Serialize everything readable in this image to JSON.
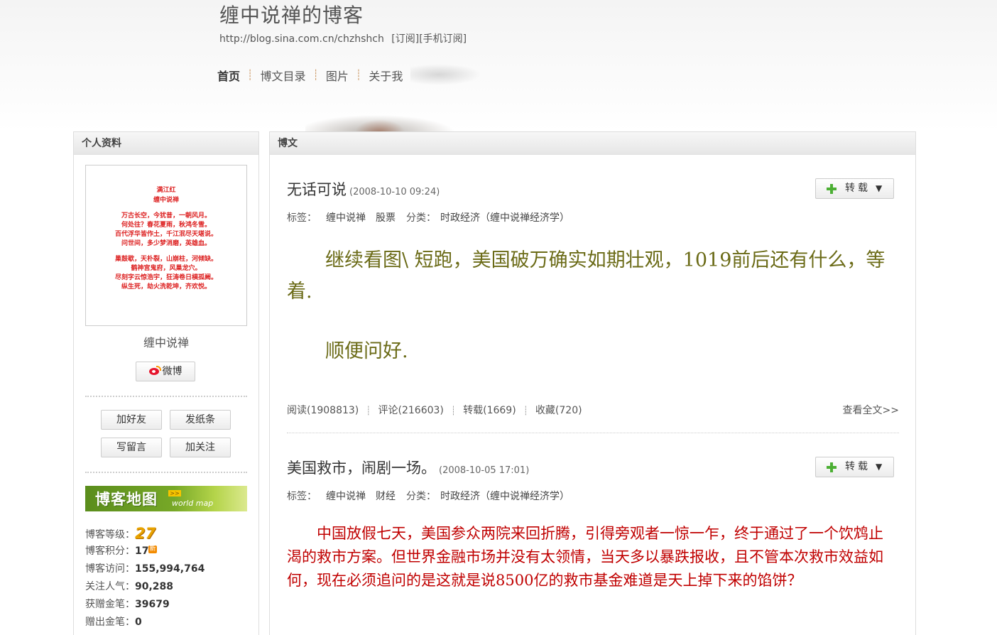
{
  "header": {
    "title": "缠中说禅的博客",
    "url": "http://blog.sina.com.cn/chzhshch",
    "subscribe": "[订阅]",
    "mobile_subscribe": "[手机订阅]"
  },
  "nav": {
    "items": [
      {
        "label": "首页"
      },
      {
        "label": "博文目录"
      },
      {
        "label": "图片"
      },
      {
        "label": "关于我"
      }
    ],
    "separator": "┊"
  },
  "sidebar": {
    "title": "个人资料",
    "poem": {
      "title": "满江红",
      "author": "缠中说禅",
      "lines1": [
        "万古长空，今犹昔，一朝风月。",
        "何处往？春花夏雨，秋鸿冬雪。",
        "百代浮华皆作土，千江泯尽天堪说。",
        "问世间，多少梦消磨，英雄血。"
      ],
      "lines2": [
        "巢鼓歇，天朴裂，山崩柱，河倾缺。",
        "鹤神宫鬼府，风巢龙穴。",
        "尽刻字云惊浩宇，狂涛卷日横孤阙。",
        "纵生死，劫火洗乾坤，齐欢悦。"
      ]
    },
    "nickname": "缠中说禅",
    "weibo_label": "微博",
    "buttons": {
      "add_friend": "加好友",
      "send_note": "发纸条",
      "leave_message": "写留言",
      "follow": "加关注"
    },
    "map_banner": {
      "title": "博客地图",
      "sub": "world map",
      "arrow": ">>"
    },
    "stats": {
      "level_label": "博客等级：",
      "level_value": "27",
      "points_label": "博客积分：",
      "points_value": "17",
      "new_badge": "新",
      "visits_label": "博客访问：",
      "visits_value": "155,994,764",
      "popularity_label": "关注人气：",
      "popularity_value": "90,288",
      "received_label": "获赠金笔：",
      "received_value": "39679",
      "given_label": "赠出金笔：",
      "given_value": "0"
    }
  },
  "main": {
    "title": "博文",
    "posts": [
      {
        "title": "无话可说",
        "time": "(2008-10-10 09:24)",
        "repost_label": "转载",
        "tags_label": "标签：",
        "tags": [
          "缠中说禅",
          "股票"
        ],
        "category_label": "分类：",
        "category": "时政经济（缠中说禅经济学）",
        "paragraphs": [
          "　　继续看图\\  短跑，美国破万确实如期壮观，1019前后还有什么，等着.",
          "　　顺便问好."
        ],
        "reads": "阅读(1908813)",
        "comments": "评论(216603)",
        "reposts": "转载(1669)",
        "favorites": "收藏(720)",
        "read_more": "查看全文>>"
      },
      {
        "title": "美国救市，闹剧一场。",
        "time": "(2008-10-05 17:01)",
        "repost_label": "转载",
        "tags_label": "标签：",
        "tags": [
          "缠中说禅",
          "财经"
        ],
        "category_label": "分类：",
        "category": "时政经济（缠中说禅经济学）",
        "paragraphs": [
          "　　中国放假七天，美国参众两院来回折腾，引得旁观者一惊一乍，终于通过了一个饮鸩止渴的救市方案。但世界金融市场并没有太领情，当天多以暴跌报收，且不管本次救市效益如何，现在必须追问的是这就是说8500亿的救市基金难道是天上掉下来的馅饼？"
        ]
      }
    ]
  }
}
